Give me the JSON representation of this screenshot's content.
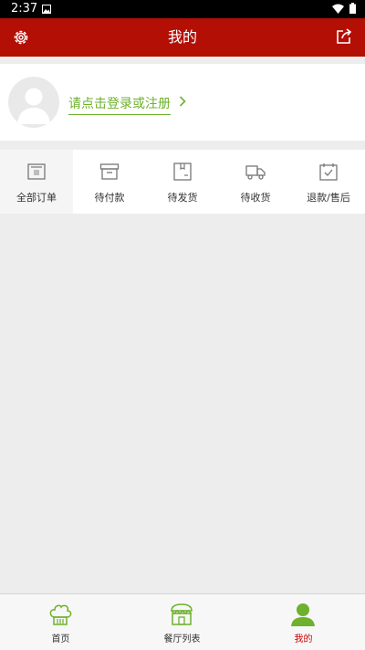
{
  "status_bar": {
    "time": "2:37"
  },
  "app_bar": {
    "title": "我的"
  },
  "profile": {
    "login_prompt": "请点击登录或注册"
  },
  "orders": [
    {
      "label": "全部订单",
      "icon": "order-list-icon"
    },
    {
      "label": "待付款",
      "icon": "box-icon"
    },
    {
      "label": "待发货",
      "icon": "package-icon"
    },
    {
      "label": "待收货",
      "icon": "truck-icon"
    },
    {
      "label": "退款/售后",
      "icon": "calendar-check-icon"
    }
  ],
  "bottom_nav": {
    "items": [
      {
        "label": "首页",
        "icon": "chef-hat-icon",
        "active": false
      },
      {
        "label": "餐厅列表",
        "icon": "restaurant-icon",
        "active": false
      },
      {
        "label": "我的",
        "icon": "user-icon",
        "active": true
      }
    ]
  },
  "colors": {
    "primary": "#b30f05",
    "accent_green": "#6db12c",
    "active_nav": "#cc0000"
  }
}
